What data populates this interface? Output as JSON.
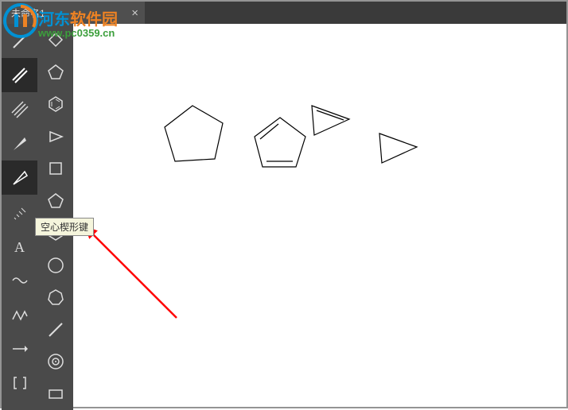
{
  "tab": {
    "title": "未命名1",
    "close": "×"
  },
  "tooltip": {
    "text": "空心楔形键"
  },
  "watermark": {
    "line1a": "河东",
    "line1b": "软件园",
    "line2": "www.pc0359.cn"
  },
  "tools_left": [
    {
      "name": "single-line-tool",
      "active": false
    },
    {
      "name": "double-line-tool",
      "active": true
    },
    {
      "name": "triple-line-tool",
      "active": false
    },
    {
      "name": "solid-wedge-tool",
      "active": false
    },
    {
      "name": "hollow-wedge-tool",
      "active": true
    },
    {
      "name": "hash-wedge-tool",
      "active": false
    },
    {
      "name": "text-tool",
      "active": false
    },
    {
      "name": "wavy-bond-tool",
      "active": false
    },
    {
      "name": "chain-tool",
      "active": false
    },
    {
      "name": "arrow-tool",
      "active": false
    },
    {
      "name": "bracket-tool",
      "active": false
    }
  ],
  "tools_right": [
    {
      "name": "cyclobutane-tool"
    },
    {
      "name": "cyclopentane-tool"
    },
    {
      "name": "benzene-tool"
    },
    {
      "name": "triangle-tool"
    },
    {
      "name": "square-tool"
    },
    {
      "name": "pentagon-tool"
    },
    {
      "name": "hexagon-tool"
    },
    {
      "name": "circle-tool"
    },
    {
      "name": "heptagon-tool"
    },
    {
      "name": "octagon-line-tool"
    },
    {
      "name": "target-tool"
    },
    {
      "name": "rect-tool"
    }
  ]
}
